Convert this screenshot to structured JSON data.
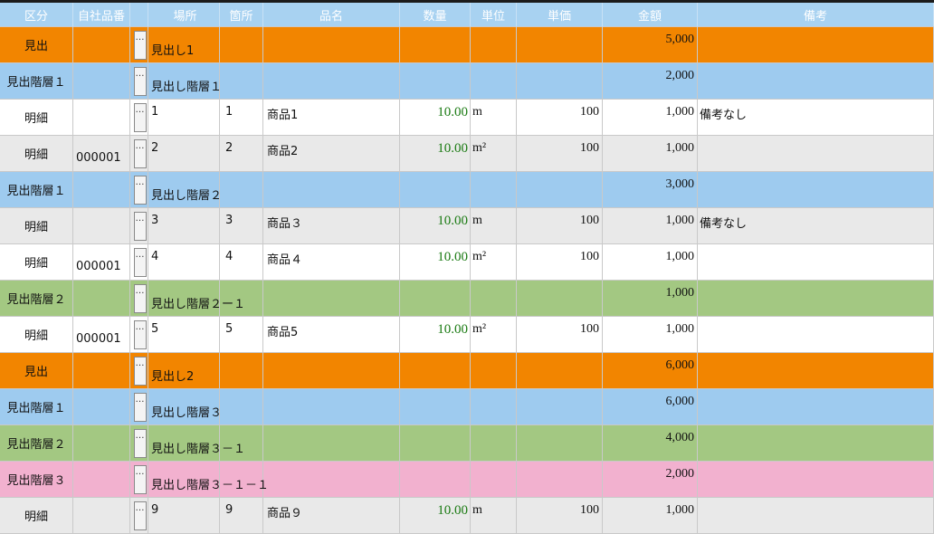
{
  "headers": {
    "kubun": "区分",
    "hinban": "自社品番",
    "basho": "場所",
    "kasho": "箇所",
    "hinmei": "品名",
    "suryo": "数量",
    "tani": "単位",
    "tanka": "単価",
    "kingaku": "金額",
    "biko": "備考"
  },
  "ellipsis": "…",
  "colors": {
    "header": "#a8d2f1",
    "heading1": "#f28500",
    "heading2": "#9ecbef",
    "heading3": "#a3c882",
    "heading4": "#f2b1cf",
    "detail_odd": "#ffffff",
    "detail_even": "#e9e9e9",
    "quantity_text": "#1a7a12"
  },
  "rows": [
    {
      "type": "heading",
      "color": "orange",
      "kubun": "見出",
      "title": "見出し1",
      "kingaku": "5,000"
    },
    {
      "type": "heading",
      "color": "blue",
      "kubun": "見出階層１",
      "title": "見出し階層１",
      "kingaku": "2,000"
    },
    {
      "type": "detail",
      "color": "white",
      "kubun": "明細",
      "hinban": "",
      "basho": "1",
      "kasho": "1",
      "hinmei": "商品1",
      "suryo": "10.00",
      "tani": "m",
      "tanka": "100",
      "kingaku": "1,000",
      "biko": "備考なし"
    },
    {
      "type": "detail",
      "color": "gray",
      "kubun": "明細",
      "hinban": "000001",
      "basho": "2",
      "kasho": "2",
      "hinmei": "商品2",
      "suryo": "10.00",
      "tani": "m²",
      "tanka": "100",
      "kingaku": "1,000",
      "biko": ""
    },
    {
      "type": "heading",
      "color": "blue",
      "kubun": "見出階層１",
      "title": "見出し階層２",
      "kingaku": "3,000"
    },
    {
      "type": "detail",
      "color": "gray",
      "kubun": "明細",
      "hinban": "",
      "basho": "3",
      "kasho": "3",
      "hinmei": "商品３",
      "suryo": "10.00",
      "tani": "m",
      "tanka": "100",
      "kingaku": "1,000",
      "biko": "備考なし"
    },
    {
      "type": "detail",
      "color": "white",
      "kubun": "明細",
      "hinban": "000001",
      "basho": "4",
      "kasho": "4",
      "hinmei": "商品４",
      "suryo": "10.00",
      "tani": "m²",
      "tanka": "100",
      "kingaku": "1,000",
      "biko": ""
    },
    {
      "type": "heading",
      "color": "green",
      "kubun": "見出階層２",
      "title": "見出し階層２ー１",
      "kingaku": "1,000"
    },
    {
      "type": "detail",
      "color": "white",
      "kubun": "明細",
      "hinban": "000001",
      "basho": "5",
      "kasho": "5",
      "hinmei": "商品5",
      "suryo": "10.00",
      "tani": "m²",
      "tanka": "100",
      "kingaku": "1,000",
      "biko": ""
    },
    {
      "type": "heading",
      "color": "orange",
      "kubun": "見出",
      "title": "見出し2",
      "kingaku": "6,000"
    },
    {
      "type": "heading",
      "color": "blue",
      "kubun": "見出階層１",
      "title": "見出し階層３",
      "kingaku": "6,000"
    },
    {
      "type": "heading",
      "color": "green",
      "kubun": "見出階層２",
      "title": "見出し階層３－１",
      "kingaku": "4,000"
    },
    {
      "type": "heading",
      "color": "pink",
      "kubun": "見出階層３",
      "title": "見出し階層３－１－１",
      "kingaku": "2,000"
    },
    {
      "type": "detail",
      "color": "gray",
      "kubun": "明細",
      "hinban": "",
      "basho": "9",
      "kasho": "9",
      "hinmei": "商品９",
      "suryo": "10.00",
      "tani": "m",
      "tanka": "100",
      "kingaku": "1,000",
      "biko": ""
    }
  ]
}
